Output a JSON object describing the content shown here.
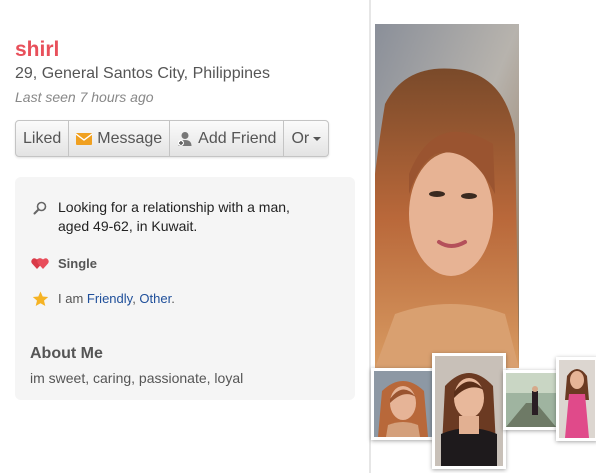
{
  "profile": {
    "name": "shirl",
    "location": "29, General Santos City, Philippines",
    "last_seen": "Last seen 7 hours ago"
  },
  "actions": {
    "liked": "Liked",
    "message": "Message",
    "add_friend": "Add Friend",
    "more": "Or"
  },
  "details": {
    "seeking": "Looking for a relationship with a man, aged 49-62, in Kuwait.",
    "status": "Single",
    "traits_prefix": "I am ",
    "traits": [
      "Friendly",
      "Other"
    ],
    "traits_sep": ", ",
    "traits_end": "."
  },
  "about": {
    "heading": "About Me",
    "text": "im sweet, caring, passionate, loyal"
  },
  "icons": {
    "search": "magnifier-icon",
    "status": "hearts-icon",
    "traits": "star-icon",
    "message": "envelope-icon",
    "add_friend": "person-add-icon"
  },
  "colors": {
    "name": "#e8505b",
    "link": "#1f4f9a",
    "heart": "#e84c5a",
    "star": "#f5b324",
    "envelope": "#f0a020"
  }
}
